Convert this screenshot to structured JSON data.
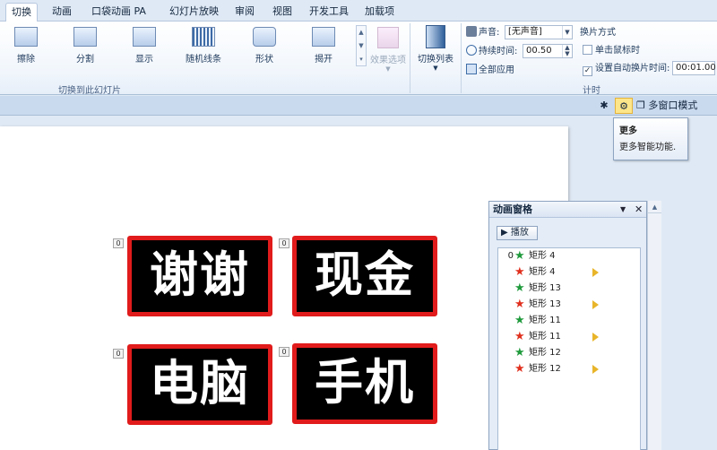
{
  "tabs": [
    {
      "label": "切换",
      "active": true
    },
    {
      "label": "动画",
      "active": false
    },
    {
      "label": "口袋动画 PA",
      "active": false
    },
    {
      "label": "幻灯片放映",
      "active": false
    },
    {
      "label": "审阅",
      "active": false
    },
    {
      "label": "视图",
      "active": false
    },
    {
      "label": "开发工具",
      "active": false
    },
    {
      "label": "加载项",
      "active": false
    }
  ],
  "ribbon": {
    "transitions": [
      "擦除",
      "分割",
      "显示",
      "随机线条",
      "形状",
      "揭开"
    ],
    "effect_options_label": "效果选项",
    "transition_group_label": "切换到此幻灯片",
    "switch_list_label": "切换列表",
    "timing": {
      "sound_label": "声音:",
      "sound_value": "[无声音]",
      "duration_label": "持续时间:",
      "duration_value": "00.50",
      "apply_all_label": "全部应用",
      "advance_title": "换片方式",
      "on_click_label": "单击鼠标时",
      "on_click_checked": false,
      "after_label": "设置自动换片时间:",
      "after_checked": true,
      "after_value": "00:01.00",
      "group_label": "计时"
    }
  },
  "subbar": {
    "multiwindow_label": "多窗口模式"
  },
  "tooltip": {
    "title": "更多",
    "body": "更多智能功能."
  },
  "slide": {
    "tiles": [
      {
        "text": "谢谢",
        "tag": "0"
      },
      {
        "text": "现金",
        "tag": "0"
      },
      {
        "text": "电脑",
        "tag": "0"
      },
      {
        "text": "手机",
        "tag": "0"
      }
    ]
  },
  "animation_pane": {
    "title": "动画窗格",
    "play_label": "播放",
    "items": [
      {
        "num": "0",
        "name": "矩形 4",
        "star": "green",
        "trigger": false
      },
      {
        "num": "",
        "name": "矩形 4",
        "star": "red",
        "trigger": true
      },
      {
        "num": "",
        "name": "矩形 13",
        "star": "green",
        "trigger": false
      },
      {
        "num": "",
        "name": "矩形 13",
        "star": "red",
        "trigger": true
      },
      {
        "num": "",
        "name": "矩形 11",
        "star": "green",
        "trigger": false
      },
      {
        "num": "",
        "name": "矩形 11",
        "star": "red",
        "trigger": true
      },
      {
        "num": "",
        "name": "矩形 12",
        "star": "green",
        "trigger": false
      },
      {
        "num": "",
        "name": "矩形 12",
        "star": "red",
        "trigger": true
      }
    ]
  },
  "colors": {
    "tile_border": "#e11b1b",
    "tile_fill": "#000000",
    "star_green": "#1f9a3c",
    "star_red": "#e0301e",
    "trigger": "#e8b52a"
  },
  "icons": [
    "play-icon",
    "collapse-arrow-icon",
    "close-icon",
    "sound-icon",
    "clock-icon",
    "apply-all-icon",
    "star-icon",
    "gear-icon",
    "sparkle-icon",
    "window-icon",
    "trigger-arrow-icon"
  ]
}
